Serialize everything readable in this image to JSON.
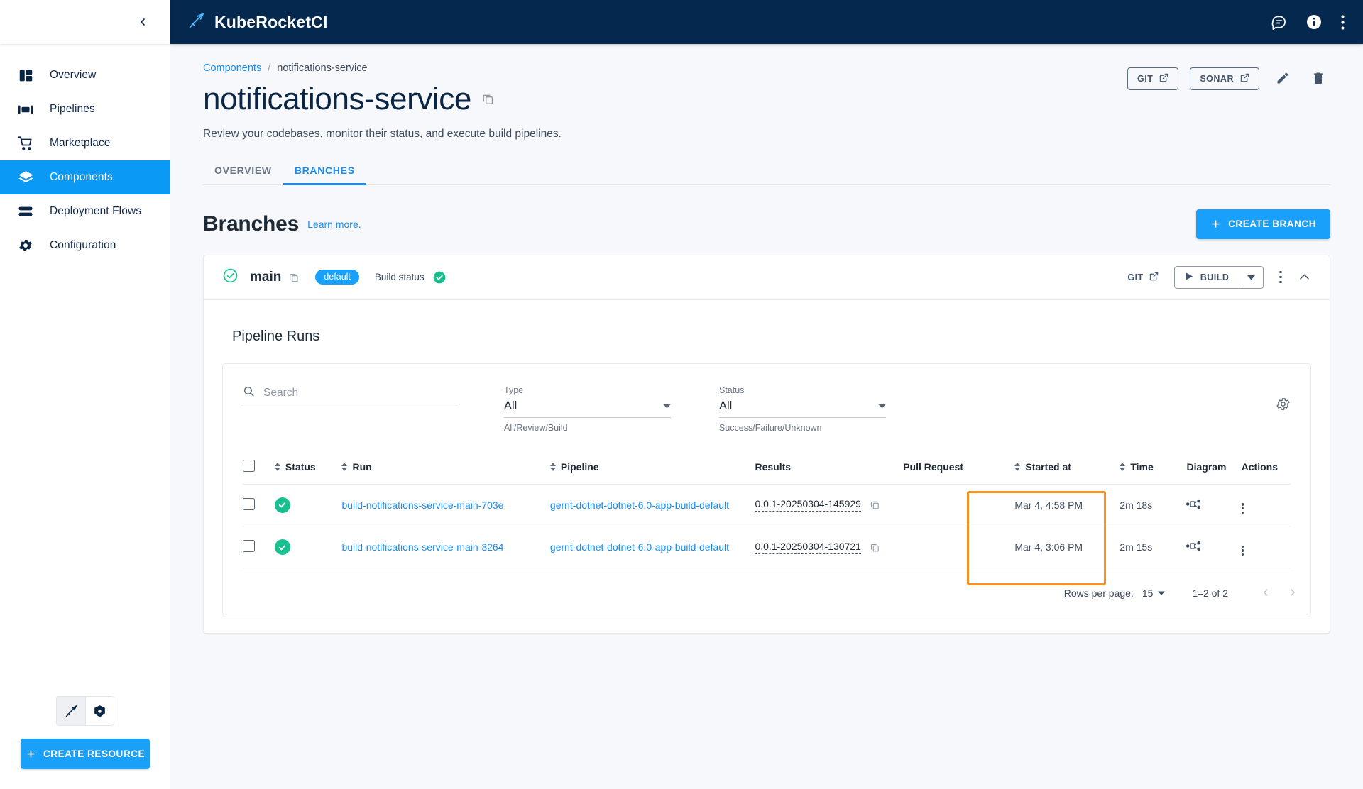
{
  "app": {
    "brand": "KubeRocketCI",
    "topbar_icons": [
      "chat-icon",
      "info-icon",
      "kebab-menu-icon"
    ]
  },
  "sidebar": {
    "collapse_icon": "chevron-left-icon",
    "items": [
      {
        "label": "Overview",
        "icon": "dashboard-icon",
        "active": false
      },
      {
        "label": "Pipelines",
        "icon": "pipelines-icon",
        "active": false
      },
      {
        "label": "Marketplace",
        "icon": "cart-icon",
        "active": false
      },
      {
        "label": "Components",
        "icon": "layers-icon",
        "active": true
      },
      {
        "label": "Deployment Flows",
        "icon": "flows-icon",
        "active": false
      },
      {
        "label": "Configuration",
        "icon": "gear-icon",
        "active": false
      }
    ],
    "cluster_switch": [
      "krci-icon",
      "kubernetes-icon"
    ],
    "create_resource_label": "CREATE RESOURCE"
  },
  "breadcrumb": {
    "root": "Components",
    "separator": "/",
    "current": "notifications-service"
  },
  "page": {
    "title": "notifications-service",
    "copy_icon": "copy-icon",
    "subtitle": "Review your codebases, monitor their status, and execute build pipelines.",
    "actions": {
      "git_label": "GIT",
      "sonar_label": "SONAR",
      "edit_icon": "pencil-icon",
      "delete_icon": "trash-icon",
      "external_icon": "external-link-icon"
    }
  },
  "tabs": [
    {
      "label": "OVERVIEW",
      "active": false
    },
    {
      "label": "BRANCHES",
      "active": true
    }
  ],
  "section": {
    "title": "Branches",
    "learn_more": "Learn more.",
    "create_button": "CREATE BRANCH"
  },
  "branch": {
    "status_icon": "check-circle-outline-icon",
    "name": "main",
    "copy_icon": "copy-icon",
    "badge": "default",
    "build_status_label": "Build status",
    "build_status_icon": "check-circle-filled-icon",
    "git_label": "GIT",
    "build_label": "BUILD",
    "kebab_icon": "kebab-menu-icon",
    "collapse_icon": "chevron-up-icon"
  },
  "runs": {
    "title": "Pipeline Runs",
    "search": {
      "placeholder": "Search",
      "value": "",
      "icon": "search-icon"
    },
    "filters": [
      {
        "label": "Type",
        "value": "All",
        "help": "All/Review/Build"
      },
      {
        "label": "Status",
        "value": "All",
        "help": "Success/Failure/Unknown"
      }
    ],
    "settings_icon": "gear-icon",
    "columns": [
      {
        "label": "",
        "sortable": false
      },
      {
        "label": "Status",
        "sortable": true
      },
      {
        "label": "Run",
        "sortable": true
      },
      {
        "label": "Pipeline",
        "sortable": true
      },
      {
        "label": "Results",
        "sortable": false
      },
      {
        "label": "Pull Request",
        "sortable": false
      },
      {
        "label": "Started at",
        "sortable": true
      },
      {
        "label": "Time",
        "sortable": true
      },
      {
        "label": "Diagram",
        "sortable": false
      },
      {
        "label": "Actions",
        "sortable": false
      }
    ],
    "rows": [
      {
        "status": "success",
        "run": "build-notifications-service-main-703e",
        "pipeline": "gerrit-dotnet-dotnet-6.0-app-build-default",
        "results": "0.0.1-20250304-145929",
        "pull_request": "",
        "started_at": "Mar 4, 4:58 PM",
        "time": "2m 18s",
        "diagram_icon": "diagram-icon",
        "actions_icon": "kebab-menu-icon"
      },
      {
        "status": "success",
        "run": "build-notifications-service-main-3264",
        "pipeline": "gerrit-dotnet-dotnet-6.0-app-build-default",
        "results": "0.0.1-20250304-130721",
        "pull_request": "",
        "started_at": "Mar 4, 3:06 PM",
        "time": "2m 15s",
        "diagram_icon": "diagram-icon",
        "actions_icon": "kebab-menu-icon"
      }
    ],
    "pagination": {
      "rows_per_page_label": "Rows per page:",
      "rows_per_page_value": "15",
      "range": "1–2 of 2",
      "prev_icon": "chevron-left-icon",
      "next_icon": "chevron-right-icon"
    }
  },
  "colors": {
    "accent": "#18a0fb",
    "topbar": "#05284f",
    "success": "#17c08e",
    "highlight": "#f7941d",
    "page_bg": "#f7f8fb"
  }
}
